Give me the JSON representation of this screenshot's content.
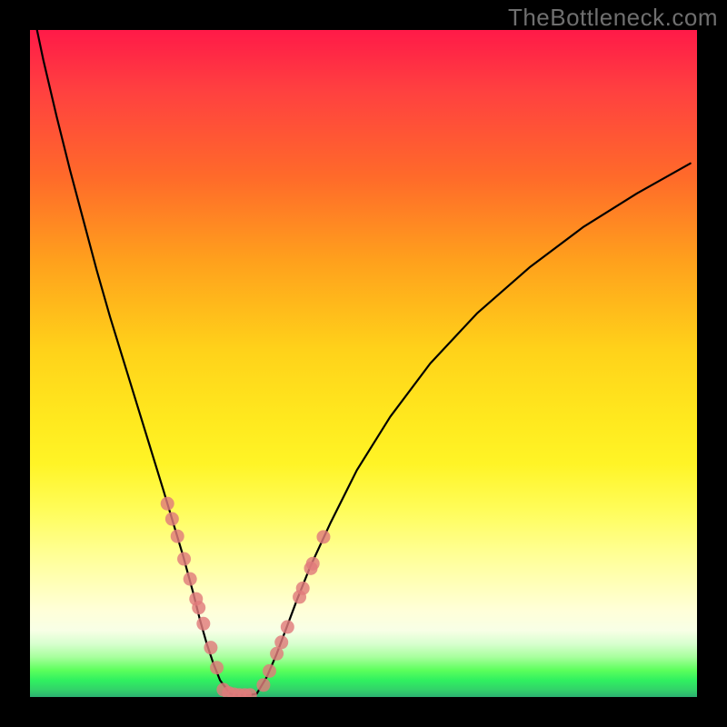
{
  "watermark": "TheBottleneck.com",
  "chart_data": {
    "type": "line",
    "title": "",
    "xlabel": "",
    "ylabel": "",
    "xlim": [
      0,
      1
    ],
    "ylim": [
      0,
      1
    ],
    "left_curve": {
      "x": [
        0.0,
        0.02,
        0.04,
        0.06,
        0.08,
        0.1,
        0.12,
        0.14,
        0.16,
        0.18,
        0.2,
        0.215,
        0.23,
        0.245,
        0.255,
        0.265,
        0.275,
        0.285,
        0.3
      ],
      "y": [
        1.05,
        0.955,
        0.87,
        0.79,
        0.715,
        0.64,
        0.57,
        0.505,
        0.44,
        0.375,
        0.31,
        0.26,
        0.21,
        0.155,
        0.115,
        0.08,
        0.05,
        0.025,
        0.005
      ]
    },
    "right_curve": {
      "x": [
        0.34,
        0.355,
        0.37,
        0.385,
        0.4,
        0.42,
        0.45,
        0.49,
        0.54,
        0.6,
        0.67,
        0.75,
        0.83,
        0.91,
        0.99
      ],
      "y": [
        0.005,
        0.03,
        0.065,
        0.105,
        0.145,
        0.195,
        0.26,
        0.34,
        0.42,
        0.5,
        0.575,
        0.645,
        0.705,
        0.755,
        0.8
      ]
    },
    "bottom_flat": {
      "x": [
        0.3,
        0.31,
        0.32,
        0.33,
        0.34
      ],
      "y": [
        0.005,
        0.003,
        0.003,
        0.003,
        0.005
      ]
    },
    "markers_left": {
      "x": [
        0.206,
        0.213,
        0.221,
        0.231,
        0.24,
        0.249,
        0.253,
        0.26,
        0.271,
        0.28,
        0.29,
        0.298,
        0.306,
        0.314,
        0.322,
        0.33
      ],
      "y": [
        0.29,
        0.267,
        0.241,
        0.207,
        0.177,
        0.147,
        0.134,
        0.11,
        0.074,
        0.044,
        0.011,
        0.006,
        0.004,
        0.003,
        0.003,
        0.003
      ]
    },
    "markers_right": {
      "x": [
        0.35,
        0.359,
        0.37,
        0.377,
        0.386,
        0.404,
        0.409,
        0.421,
        0.424,
        0.44
      ],
      "y": [
        0.018,
        0.039,
        0.065,
        0.082,
        0.105,
        0.15,
        0.163,
        0.193,
        0.2,
        0.24
      ]
    },
    "marker_color": "#e07b7b",
    "curve_color": "#000000"
  }
}
